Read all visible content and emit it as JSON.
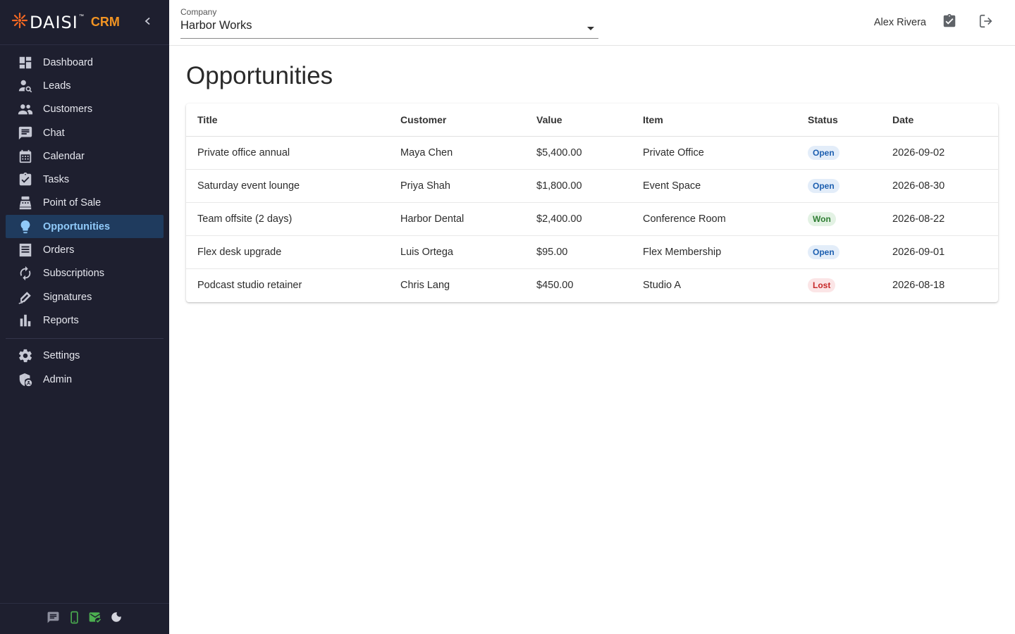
{
  "brand": {
    "name": "DAISI",
    "tm": "™",
    "product": "CRM"
  },
  "nav": {
    "items": [
      {
        "label": "Dashboard",
        "icon": "dashboard-icon"
      },
      {
        "label": "Leads",
        "icon": "person-search-icon"
      },
      {
        "label": "Customers",
        "icon": "people-icon"
      },
      {
        "label": "Chat",
        "icon": "chat-icon"
      },
      {
        "label": "Calendar",
        "icon": "calendar-icon"
      },
      {
        "label": "Tasks",
        "icon": "task-check-icon"
      },
      {
        "label": "Point of Sale",
        "icon": "cash-register-icon"
      },
      {
        "label": "Opportunities",
        "icon": "lightbulb-icon",
        "active": true
      },
      {
        "label": "Orders",
        "icon": "receipt-icon"
      },
      {
        "label": "Subscriptions",
        "icon": "autorenew-icon"
      },
      {
        "label": "Signatures",
        "icon": "signature-icon"
      },
      {
        "label": "Reports",
        "icon": "bar-chart-icon"
      }
    ],
    "secondary": [
      {
        "label": "Settings",
        "icon": "gear-icon"
      },
      {
        "label": "Admin",
        "icon": "admin-shield-icon"
      }
    ]
  },
  "header": {
    "company_caption": "Company",
    "company_value": "Harbor Works",
    "user_name": "Alex Rivera"
  },
  "page": {
    "title": "Opportunities"
  },
  "table": {
    "columns": [
      "Title",
      "Customer",
      "Value",
      "Item",
      "Status",
      "Date"
    ],
    "rows": [
      {
        "title": "Private office annual",
        "customer": "Maya Chen",
        "value": "$5,400.00",
        "item": "Private Office",
        "status": "Open",
        "status_kind": "open",
        "date": "2026-09-02"
      },
      {
        "title": "Saturday event lounge",
        "customer": "Priya Shah",
        "value": "$1,800.00",
        "item": "Event Space",
        "status": "Open",
        "status_kind": "open",
        "date": "2026-08-30"
      },
      {
        "title": "Team offsite (2 days)",
        "customer": "Harbor Dental",
        "value": "$2,400.00",
        "item": "Conference Room",
        "status": "Won",
        "status_kind": "won",
        "date": "2026-08-22"
      },
      {
        "title": "Flex desk upgrade",
        "customer": "Luis Ortega",
        "value": "$95.00",
        "item": "Flex Membership",
        "status": "Open",
        "status_kind": "open",
        "date": "2026-09-01"
      },
      {
        "title": "Podcast studio retainer",
        "customer": "Chris Lang",
        "value": "$450.00",
        "item": "Studio A",
        "status": "Lost",
        "status_kind": "lost",
        "date": "2026-08-18"
      }
    ]
  },
  "colors": {
    "sidebar_bg": "#1e1f2f",
    "accent_orange": "#f29423",
    "active_bg": "#1f3b5e",
    "active_text": "#90caf9",
    "status_ok_green": "#4caf50"
  }
}
